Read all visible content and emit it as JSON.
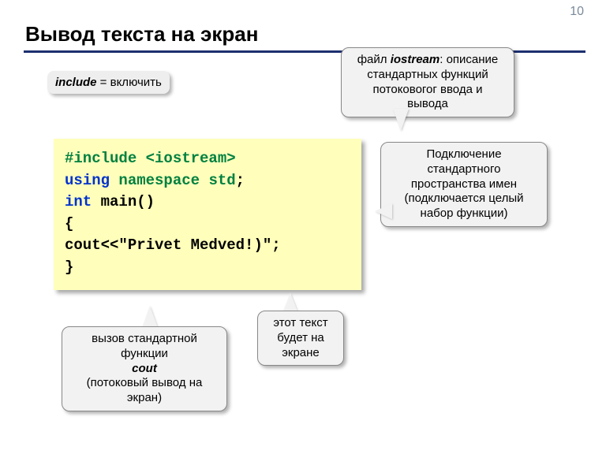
{
  "page_number": "10",
  "title": "Вывод текста на экран",
  "callouts": {
    "include_def": {
      "keyword": "include",
      "rest": " = включить"
    },
    "iostream_desc": {
      "prefix": "файл ",
      "keyword": "iostream",
      "rest": ": описание стандартных функций потоковогог ввода и вывода"
    },
    "namespace_desc": "Подключение стандартного пространства имен (подключается целый набор функции)",
    "cout_desc": {
      "line1": "вызов стандартной функции",
      "keyword": "cout",
      "line2": "(потоковый вывод на экран)"
    },
    "text_desc": "этот текст будет на экране"
  },
  "code": {
    "line1": {
      "directive": "#include",
      "header": " <iostream>"
    },
    "line2": {
      "kw1": "using",
      "mid": " namespace ",
      "kw2": "std",
      "end": ";"
    },
    "line3": {
      "type": "int",
      "rest": " main()"
    },
    "line4": "{",
    "line5": {
      "indent": "   ",
      "obj": "cout",
      "rest": "<<\"Privet Medved!)\";"
    },
    "line6": "}"
  }
}
